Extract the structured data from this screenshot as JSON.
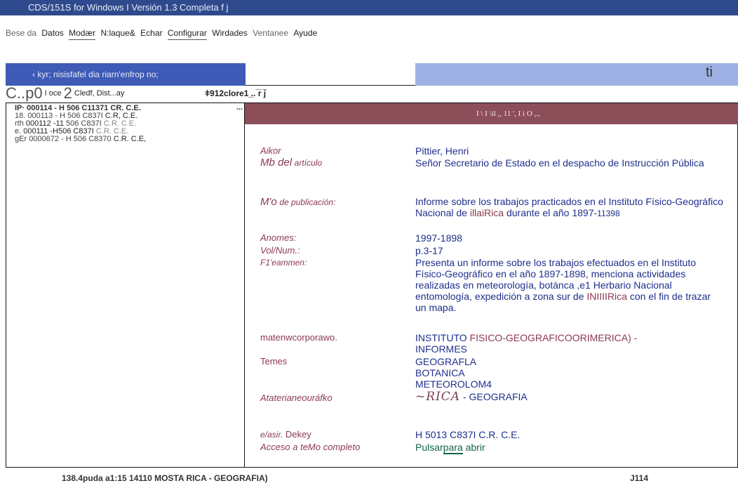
{
  "window": {
    "title": "CDS/151S for Windows I Versión 1.3 Completa f j"
  },
  "menu": {
    "items": [
      {
        "label": "Bese da",
        "style": "muted"
      },
      {
        "label": "Datos",
        "style": "normal"
      },
      {
        "label": "Modær",
        "style": "under"
      },
      {
        "label": "N:laque&",
        "style": "normal"
      },
      {
        "label": "Echar",
        "style": "normal"
      },
      {
        "label": "Configurar",
        "style": "under"
      },
      {
        "label": "Wirdades",
        "style": "normal"
      },
      {
        "label": "Ventanee",
        "style": "muted"
      },
      {
        "label": "Ayude",
        "style": "normal"
      }
    ]
  },
  "toolbar": {
    "search_text": "‹  kyr; nisisfafel dia riarn'enfrop no;",
    "right_glyph": "ti"
  },
  "column_header": {
    "col_a_big": "C..p0",
    "col_a_small": "I oce",
    "col_a_big2": "2",
    "col_a_tail": "Cledf, Dist...ay",
    "col_b": "ǂ912clore1 ̲.. ̅r̅ j̅"
  },
  "results": [
    {
      "prefix": "IP·",
      "id": "000114 -",
      "code": "H 506 C11371 CR. C.E.",
      "cc": "",
      "more": "..."
    },
    {
      "prefix": "18.",
      "id": "000113 -",
      "code": "H 506 C837I",
      "cc": "C.R, C.E."
    },
    {
      "prefix": "rth",
      "id": "000112 -11",
      "code": "506 C837I",
      "cc": "C.R. C.E."
    },
    {
      "prefix": "e.",
      "id": "000111 -H506",
      "code": "C837I",
      "cc": "C.R. C.E."
    },
    {
      "prefix": "gEr",
      "id": "0000672 -",
      "code": "H 506 C8370",
      "cc": "C.R. C.E,"
    }
  ],
  "detail": {
    "strip_text": "I \\ I \\il ,, 11 ', I i O ,.,",
    "fields": {
      "author": {
        "label": "Aikor",
        "value": "Pittier, Henri"
      },
      "article_title": {
        "label_big": "Mb del",
        "label_small": "artículo",
        "value": "Señor Secretario de Estado en el despacho de Instrucción Pública"
      },
      "publication": {
        "label_big": "M'o",
        "label_small": "de publicación:",
        "value_a": "Informe sobre los trabajos practicados en el Instituto Físico-Geográfico Nacional de",
        "value_accent": "illaiRica",
        "value_b": "durante el año 1897-",
        "value_dim": "11398"
      },
      "years": {
        "label": "Anomes:",
        "value": "1997-1898"
      },
      "volume": {
        "label": "Vol/Num.:",
        "value": "p.3-17"
      },
      "summary": {
        "label": "F1'eammen:",
        "value_a": "Presenta un informe sobre los trabajos efectuados en el Instituto Físico-Geográfico en el año 1897-1898, menciona actividades realizadas en meteorología, botánca ,e1 Herbario Nacional entomología, expedición a zona sur de",
        "value_accent": "INIIIIRica",
        "value_b": "con el fin de trazar un mapa."
      },
      "corporate": {
        "label": "matenwcorporawo.",
        "value_a": "INSTITUTO",
        "value_accent": "FISICO-GEOGRAFICOORIMERICA) -",
        "value_b": "INFORMES"
      },
      "topics": {
        "label": "Temes",
        "values": [
          "GEOGRAFLA",
          "BOTANICA",
          "METEOROLOM4"
        ]
      },
      "geo": {
        "label": "Ataterianeouráfko",
        "value_script": "~RICA",
        "value_b": "- GEOGRAFIA"
      },
      "classification": {
        "label_small": "e/asir.",
        "label": "Dekey",
        "value": "H 5013 C837I C.R. C.E."
      },
      "fulltext": {
        "label": "Acceso a teMo completo",
        "value_a": "Pulsar",
        "value_link": "para",
        "value_b": "abrir"
      }
    }
  },
  "status": {
    "left": "138.4puda a1:15 14110 MOSTA RICA - GEOGRAFIA)",
    "right": "J114"
  },
  "colors": {
    "title_bar": "#2f4a8c",
    "search_band": "#3f5bb7",
    "toolbar_right": "#9fb0e4",
    "detail_strip": "#8c4f5a",
    "label": "#8b3a4e",
    "value": "#1f2f8c"
  }
}
